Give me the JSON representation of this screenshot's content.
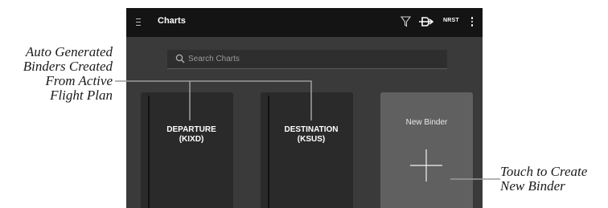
{
  "app_bar": {
    "title": "Charts",
    "nrst_label": "NRST",
    "icons": [
      "menu-icon",
      "filter-icon",
      "direct-to-icon",
      "more-vert-icon"
    ]
  },
  "search": {
    "placeholder": "Search Charts"
  },
  "binders": [
    {
      "name": "DEPARTURE",
      "code": "(KIXD)"
    },
    {
      "name": "DESTINATION",
      "code": "(KSUS)"
    }
  ],
  "new_binder": {
    "label": "New Binder"
  },
  "callouts": {
    "left": [
      "Auto Generated",
      "Binders Created",
      "From Active",
      "Flight Plan"
    ],
    "right": [
      "Touch to Create",
      "New Binder"
    ]
  }
}
